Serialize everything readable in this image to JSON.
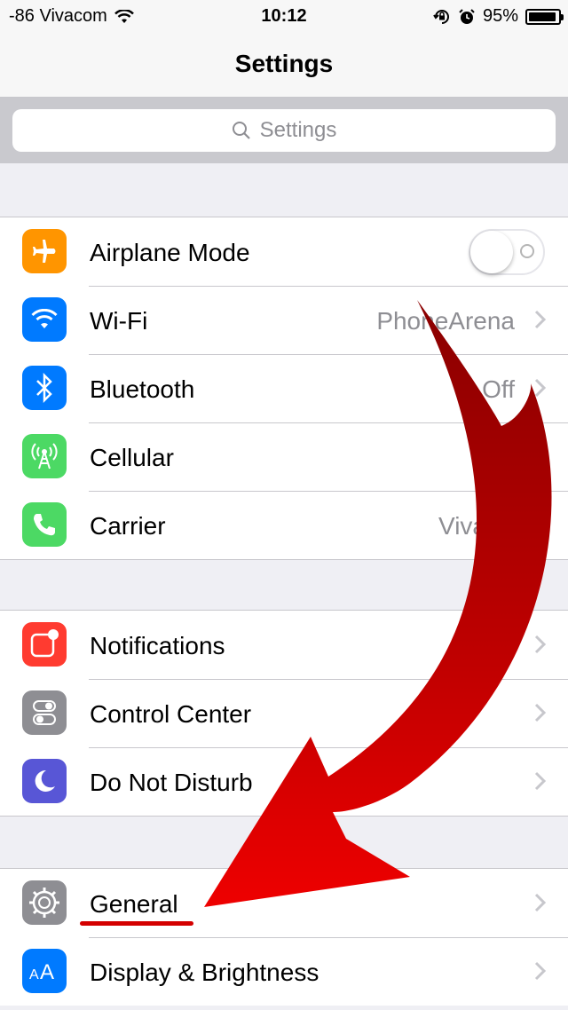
{
  "status_bar": {
    "carrier": "-86 Vivacom",
    "time": "10:12",
    "battery_percent": "95%",
    "battery_level": 0.95,
    "icons": [
      "wifi-icon",
      "orientation-lock-icon",
      "alarm-icon",
      "battery-icon"
    ]
  },
  "nav": {
    "title": "Settings"
  },
  "search": {
    "placeholder": "Settings",
    "icon": "search-icon"
  },
  "groups": [
    {
      "rows": [
        {
          "label": "Airplane Mode",
          "icon": "airplane-icon",
          "icon_color": "#ff9500",
          "control": "toggle",
          "toggle_on": false
        },
        {
          "label": "Wi-Fi",
          "icon": "wifi-icon",
          "icon_color": "#007aff",
          "value": "PhoneArena"
        },
        {
          "label": "Bluetooth",
          "icon": "bluetooth-icon",
          "icon_color": "#007aff",
          "value": "Off"
        },
        {
          "label": "Cellular",
          "icon": "cellular-antenna-icon",
          "icon_color": "#4cd964"
        },
        {
          "label": "Carrier",
          "icon": "phone-icon",
          "icon_color": "#4cd964",
          "value": "Viva"
        }
      ]
    },
    {
      "rows": [
        {
          "label": "Notifications",
          "icon": "notifications-icon",
          "icon_color": "#ff3b30"
        },
        {
          "label": "Control Center",
          "icon": "control-center-icon",
          "icon_color": "#8e8e93"
        },
        {
          "label": "Do Not Disturb",
          "icon": "moon-icon",
          "icon_color": "#5856d6"
        }
      ]
    },
    {
      "rows": [
        {
          "label": "General",
          "icon": "gear-icon",
          "icon_color": "#8e8e93"
        },
        {
          "label": "Display & Brightness",
          "icon": "text-size-icon",
          "icon_color": "#007aff"
        }
      ]
    }
  ],
  "annotation": {
    "arrow_color": "#cc0000",
    "underline_color": "#d40000"
  }
}
